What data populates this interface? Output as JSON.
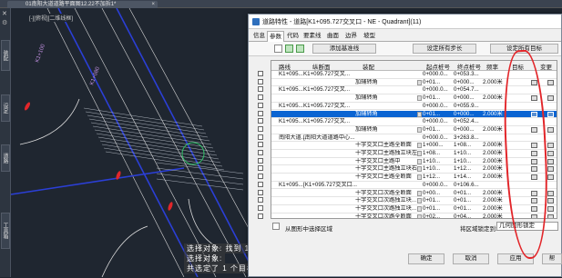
{
  "document_tab": {
    "title": "01南阳大道道路平面图12.22不加拆1*"
  },
  "palette": {
    "tabs": [
      "装配",
      "设定",
      "道路",
      "工具箱"
    ]
  },
  "viewport": {
    "label": "[-][俯视][二维线框]"
  },
  "command_line": {
    "lines": [
      "选择对象: 找到 1 个",
      "选择对象:",
      "共选定了 1 个目标"
    ]
  },
  "dialog": {
    "title": "道路特性 - 道路[K1+095.727交叉口 - NE - Quadrant](11)",
    "tabs": [
      "信息",
      "参数",
      "代码",
      "要素线",
      "曲面",
      "边界",
      "坡型"
    ],
    "active_tab": "参数",
    "buttons": {
      "add_baseline": "添加基准线",
      "set_all_step": "设定所有步长",
      "set_all_target": "设定所有目标"
    },
    "columns": [
      "路线",
      "纵断面",
      "装配",
      "起点桩号",
      "终点桩号",
      "频率",
      "目标",
      "变更"
    ],
    "rows": [
      {
        "route": "K1+095...",
        "profile": "K1+095.727交叉...",
        "assembly": "",
        "start": "0+000.0...",
        "end": "0+053.3...",
        "freq": "",
        "target": "",
        "sel": false
      },
      {
        "route": "",
        "profile": "",
        "assembly": "加辅转角",
        "start": "0+01...",
        "end": "0+000...",
        "freq": "2.000米",
        "target": "",
        "sel": false
      },
      {
        "route": "K1+095...",
        "profile": "K1+095.727交叉...",
        "assembly": "",
        "start": "0+000.0...",
        "end": "0+054.7...",
        "freq": "",
        "target": "",
        "sel": false
      },
      {
        "route": "",
        "profile": "",
        "assembly": "加辅转角",
        "start": "0+01...",
        "end": "0+000...",
        "freq": "2.000米",
        "target": "",
        "sel": false
      },
      {
        "route": "K1+095...",
        "profile": "K1+095.727交叉...",
        "assembly": "",
        "start": "0+000.0...",
        "end": "0+055.9...",
        "freq": "",
        "target": "",
        "sel": false
      },
      {
        "route": "",
        "profile": "",
        "assembly": "加辅转角",
        "start": "0+01...",
        "end": "0+000...",
        "freq": "2.000米",
        "target": "",
        "sel": true
      },
      {
        "route": "K1+095...",
        "profile": "K1+095.727交叉...",
        "assembly": "",
        "start": "0+000.0...",
        "end": "0+052.4...",
        "freq": "",
        "target": "",
        "sel": false
      },
      {
        "route": "",
        "profile": "",
        "assembly": "加辅转角",
        "start": "0+01...",
        "end": "0+000...",
        "freq": "2.000米",
        "target": "",
        "sel": false
      },
      {
        "route": "南阳大道...",
        "profile": "[南阳大道道路中心...",
        "assembly": "",
        "start": "0+000.0...",
        "end": "3+263.8...",
        "freq": "",
        "target": "",
        "sel": false
      },
      {
        "route": "",
        "profile": "",
        "assembly": "十字交叉口主路全断面",
        "start": "1+000...",
        "end": "1+08...",
        "freq": "2.000米",
        "target": "",
        "sel": false
      },
      {
        "route": "",
        "profile": "",
        "assembly": "十字交叉口主路独立块左",
        "start": "1+08...",
        "end": "1+10...",
        "freq": "2.000米",
        "target": "",
        "sel": false
      },
      {
        "route": "",
        "profile": "",
        "assembly": "十字交叉口主路中",
        "start": "1+10...",
        "end": "1+10...",
        "freq": "2.000米",
        "target": "",
        "sel": false
      },
      {
        "route": "",
        "profile": "",
        "assembly": "十字交叉口主路独立块右",
        "start": "1+10...",
        "end": "1+12...",
        "freq": "2.000米",
        "target": "",
        "sel": false
      },
      {
        "route": "",
        "profile": "",
        "assembly": "十字交叉口主路全断面",
        "start": "1+12...",
        "end": "1+14...",
        "freq": "2.000米",
        "target": "",
        "sel": false
      },
      {
        "route": "K1+095...",
        "profile": "[K1+095.727交叉口...",
        "assembly": "",
        "start": "0+000.0...",
        "end": "0+106.6...",
        "freq": "",
        "target": "",
        "sel": false
      },
      {
        "route": "",
        "profile": "",
        "assembly": "十字交叉口次路全断面",
        "start": "0+00...",
        "end": "0+01...",
        "freq": "2.000米",
        "target": "",
        "sel": false
      },
      {
        "route": "",
        "profile": "",
        "assembly": "十字交叉口次路独立块...",
        "start": "0+01...",
        "end": "0+01...",
        "freq": "2.000米",
        "target": "",
        "sel": false
      },
      {
        "route": "",
        "profile": "",
        "assembly": "十字交叉口次路独立块...",
        "start": "0+01...",
        "end": "0+01...",
        "freq": "2.000米",
        "target": "",
        "sel": false
      },
      {
        "route": "",
        "profile": "",
        "assembly": "十字交叉口次路全断面",
        "start": "0+02...",
        "end": "0+04...",
        "freq": "2.000米",
        "target": "",
        "sel": false
      }
    ],
    "select_region_label": "从图形中选择区域",
    "lock_label": "将区域锁定到:",
    "lock_value": "几何图形锁定",
    "footer_buttons": {
      "ok": "确定",
      "cancel": "取消",
      "apply": "应用",
      "help": "帮"
    }
  }
}
